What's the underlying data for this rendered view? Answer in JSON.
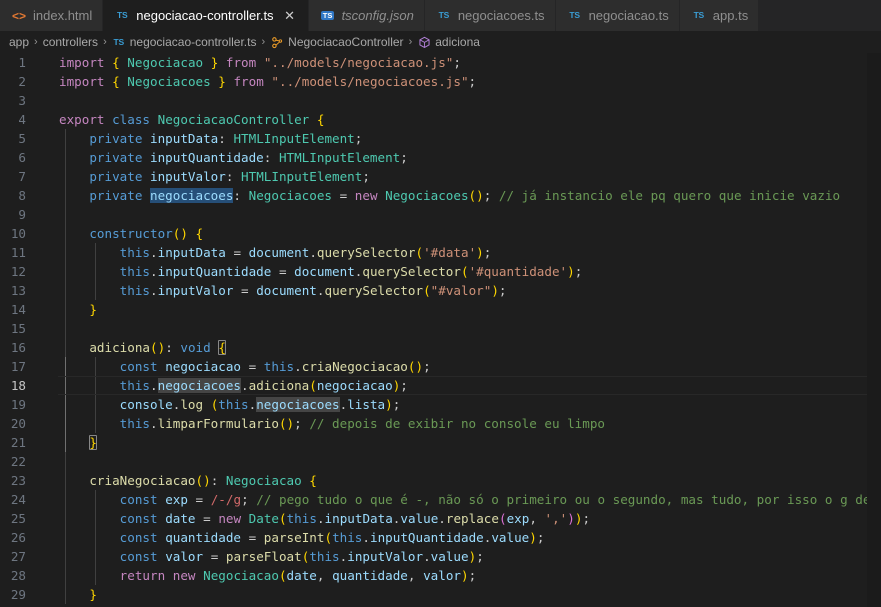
{
  "window": {
    "theme": "Dark+ (default dark)",
    "background": "#1e1e1e"
  },
  "tabs": [
    {
      "label": "index.html",
      "icon": "html5-icon",
      "active": false,
      "preview": false,
      "closable": false
    },
    {
      "label": "negociacao-controller.ts",
      "icon": "typescript-icon",
      "active": true,
      "preview": false,
      "closable": true,
      "close_glyph": "✕"
    },
    {
      "label": "tsconfig.json",
      "icon": "typescript-config-icon",
      "active": false,
      "preview": true,
      "closable": false
    },
    {
      "label": "negociacoes.ts",
      "icon": "typescript-icon",
      "active": false,
      "preview": false,
      "closable": false
    },
    {
      "label": "negociacao.ts",
      "icon": "typescript-icon",
      "active": false,
      "preview": false,
      "closable": false
    },
    {
      "label": "app.ts",
      "icon": "typescript-icon",
      "active": false,
      "preview": false,
      "closable": false
    }
  ],
  "breadcrumbs": {
    "separator": "›",
    "items": [
      {
        "label": "app",
        "icon": null
      },
      {
        "label": "controllers",
        "icon": null
      },
      {
        "label": "negociacao-controller.ts",
        "icon": "typescript-icon"
      },
      {
        "label": "NegociacaoController",
        "icon": "symbol-class-icon"
      },
      {
        "label": "adiciona",
        "icon": "symbol-method-icon"
      }
    ]
  },
  "editor": {
    "language": "TypeScript",
    "active_line": 18,
    "first_line": 1,
    "last_line": 29,
    "lines": [
      {
        "n": 1,
        "text": "import { Negociacao } from \"../models/negociacao.js\";"
      },
      {
        "n": 2,
        "text": "import { Negociacoes } from \"../models/negociacoes.js\";"
      },
      {
        "n": 3,
        "text": ""
      },
      {
        "n": 4,
        "text": "export class NegociacaoController {"
      },
      {
        "n": 5,
        "text": "    private inputData: HTMLInputElement;"
      },
      {
        "n": 6,
        "text": "    private inputQuantidade: HTMLInputElement;"
      },
      {
        "n": 7,
        "text": "    private inputValor: HTMLInputElement;"
      },
      {
        "n": 8,
        "text": "    private negociacoes: Negociacoes = new Negociacoes(); // já instancio ele pq quero que inicie vazio"
      },
      {
        "n": 9,
        "text": ""
      },
      {
        "n": 10,
        "text": "    constructor() {"
      },
      {
        "n": 11,
        "text": "        this.inputData = document.querySelector('#data');"
      },
      {
        "n": 12,
        "text": "        this.inputQuantidade = document.querySelector('#quantidade');"
      },
      {
        "n": 13,
        "text": "        this.inputValor = document.querySelector(\"#valor\");"
      },
      {
        "n": 14,
        "text": "    }"
      },
      {
        "n": 15,
        "text": ""
      },
      {
        "n": 16,
        "text": "    adiciona(): void {"
      },
      {
        "n": 17,
        "text": "        const negociacao = this.criaNegociacao();"
      },
      {
        "n": 18,
        "text": "        this.negociacoes.adiciona(negociacao);"
      },
      {
        "n": 19,
        "text": "        console.log (this.negociacoes.lista);"
      },
      {
        "n": 20,
        "text": "        this.limparFormulario(); // depois de exibir no console eu limpo"
      },
      {
        "n": 21,
        "text": "    }"
      },
      {
        "n": 22,
        "text": ""
      },
      {
        "n": 23,
        "text": "    criaNegociacao(): Negociacao {"
      },
      {
        "n": 24,
        "text": "        const exp = /-/g; // pego tudo o que é -, não só o primeiro ou o segundo, mas tudo, por isso o g de"
      },
      {
        "n": 25,
        "text": "        const date = new Date(this.inputData.value.replace(exp, ','));"
      },
      {
        "n": 26,
        "text": "        const quantidade = parseInt(this.inputQuantidade.value);"
      },
      {
        "n": 27,
        "text": "        const valor = parseFloat(this.inputValor.value);"
      },
      {
        "n": 28,
        "text": "        return new Negociacao(date, quantidade, valor);"
      },
      {
        "n": 29,
        "text": "    }"
      }
    ],
    "highlights": {
      "selection_word": "negociacoes",
      "selection_line": 8,
      "occurrence_lines": [
        18,
        19
      ],
      "bracket_match_lines": [
        16,
        21
      ]
    }
  },
  "colors": {
    "editor_background": "#1e1e1e",
    "tabbar_background": "#252526",
    "inactive_tab_background": "#2d2d2d",
    "line_number": "#6e7681",
    "active_line_number": "#c6c6c6",
    "keyword": "#c586c0",
    "keyword_control": "#569cd6",
    "type": "#4ec9b0",
    "string": "#ce9178",
    "function": "#dcdcaa",
    "variable": "#9cdcfe",
    "comment": "#6a9955",
    "selection": "#264f78",
    "word_occurrence": "#575757",
    "regexp": "#d16969",
    "number": "#b5cea8"
  }
}
